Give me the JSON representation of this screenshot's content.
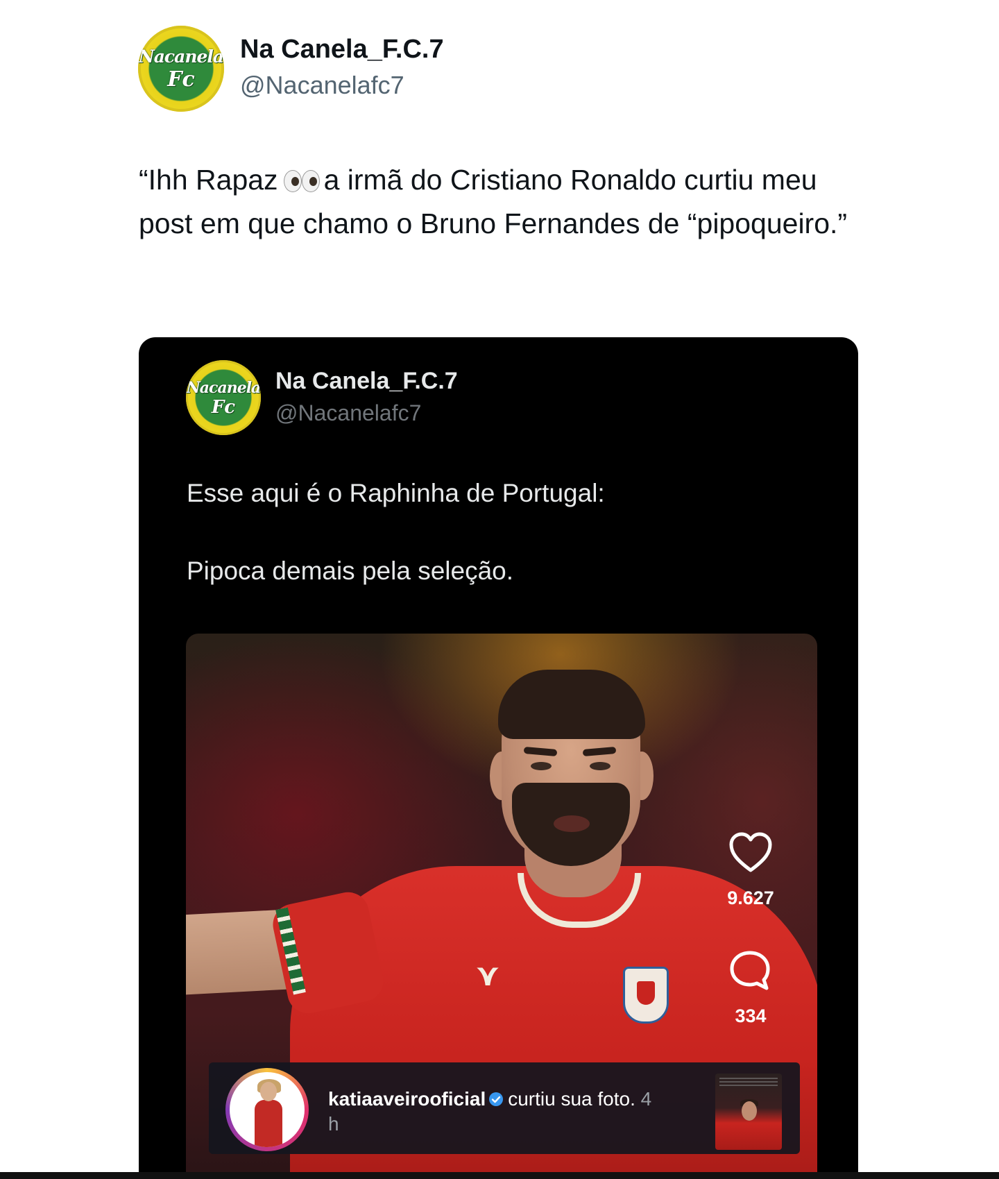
{
  "outer_tweet": {
    "avatar_logo_line1": "Nacanela",
    "avatar_logo_line2": "Fc",
    "display_name": "Na Canela_F.C.7",
    "handle": "@Nacanelafc7",
    "text_part1": "“Ihh Rapaz",
    "text_emoji": "eyes-emoji",
    "text_part2": "a irmã do Cristiano Ronaldo curtiu meu post em que chamo o Bruno Fernandes de “pipoqueiro.”"
  },
  "inner_tweet": {
    "avatar_logo_line1": "Nacanela",
    "avatar_logo_line2": "Fc",
    "display_name": "Na Canela_F.C.7",
    "handle": "@Nacanelafc7",
    "text_line1": "Esse aqui é o Raphinha de Portugal:",
    "text_line2": "Pipoca demais pela seleção.",
    "background_color": "#000000"
  },
  "photo": {
    "like_icon": "heart-icon",
    "like_count": "9.627",
    "comment_icon": "comment-icon",
    "comment_count": "334"
  },
  "notification": {
    "username": "katiaaveirooficial",
    "verified_icon": "verified-badge-icon",
    "action": "curtiu sua foto.",
    "time": "4 h"
  }
}
